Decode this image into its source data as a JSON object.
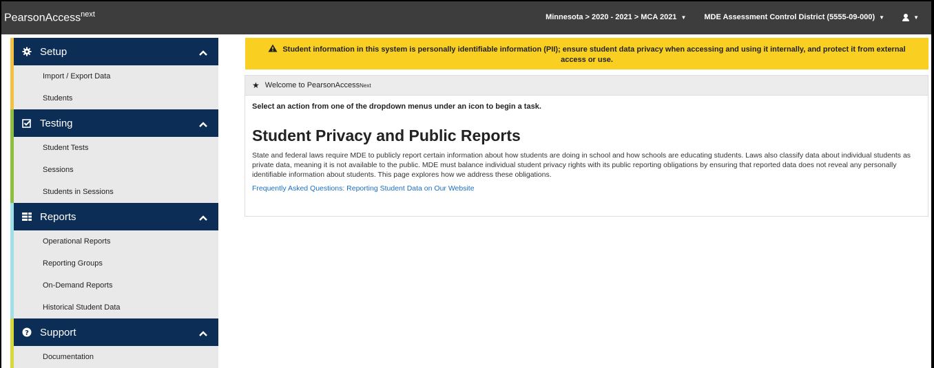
{
  "header": {
    "brand": "PearsonAccess",
    "brand_sup": "next",
    "context": "Minnesota > 2020 - 2021 > MCA 2021",
    "organization": "MDE Assessment Control District (5555-09-000)"
  },
  "sidebar": {
    "sections": [
      {
        "title": "Setup",
        "icon": "gear-icon",
        "accent": "#f4c041",
        "items": [
          "Import / Export Data",
          "Students"
        ]
      },
      {
        "title": "Testing",
        "icon": "check-square-icon",
        "accent": "#8cbf3f",
        "items": [
          "Student Tests",
          "Sessions",
          "Students in Sessions"
        ]
      },
      {
        "title": "Reports",
        "icon": "report-icon",
        "accent": "#9fdfe8",
        "items": [
          "Operational Reports",
          "Reporting Groups",
          "On-Demand Reports",
          "Historical Student Data"
        ]
      },
      {
        "title": "Support",
        "icon": "question-circle-icon",
        "accent": "#d8d83a",
        "items": [
          "Documentation"
        ]
      }
    ]
  },
  "banner": {
    "icon": "warning-icon",
    "text": "Student information in this system is personally identifiable information (PII); ensure student data privacy when accessing and using it internally, and protect it from external access or use."
  },
  "welcome": {
    "title": "Welcome to PearsonAccess",
    "title_sup": "Next",
    "instruction": "Select an action from one of the dropdown menus under an icon to begin a task.",
    "heading": "Student Privacy and Public Reports",
    "paragraph": "State and federal laws require MDE to publicly report certain information about how students are doing in school and how schools are educating students. Laws also classify data about individual students as private data, meaning it is not available to the public. MDE must balance individual student privacy rights with its public reporting obligations by ensuring that reported data does not reveal any personally identifiable information about students. This page explores how we address these obligations.",
    "link": "Frequently Asked Questions: Reporting Student Data on Our Website"
  }
}
